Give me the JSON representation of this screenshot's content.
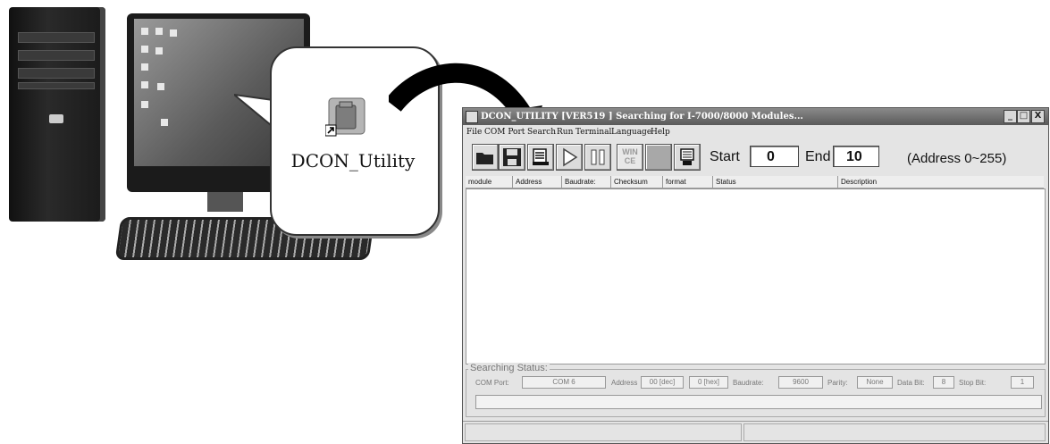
{
  "desktop_icon": {
    "label": "DCON_Utility"
  },
  "window": {
    "title": "DCON_UTILITY [VER519 ] Searching for I-7000/8000 Modules...",
    "controls": {
      "minimize": "_",
      "maximize": "□",
      "close": "X"
    }
  },
  "menu": [
    "File",
    "COM Port",
    "Search",
    "Run",
    "Terminal",
    "Language",
    "Help"
  ],
  "toolbar": {
    "buttons": [
      "open-folder-icon",
      "save-disk-icon",
      "search-modules-icon",
      "run-icon",
      "pause-icon",
      "wince-icon",
      "blank-icon",
      "terminal-icon"
    ],
    "wince_label_line1": "WIN",
    "wince_label_line2": "CE",
    "start_label": "Start",
    "start_value": "0",
    "end_label": "End",
    "end_value": "10",
    "address_hint": "(Address 0~255)"
  },
  "grid": {
    "columns": [
      "module",
      "Address",
      "Baudrate:",
      "Checksum",
      "format",
      "Status",
      "Description"
    ],
    "rows": []
  },
  "search_status": {
    "title": "Searching Status:",
    "com_port_label": "COM Port:",
    "com_port_value": "COM 6",
    "address_label": "Address",
    "address_dec": "00 [dec]",
    "address_hex": "0 [hex]",
    "baudrate_label": "Baudrate:",
    "baudrate_value": "9600",
    "parity_label": "Parity:",
    "parity_value": "None",
    "databit_label": "Data Bit:",
    "databit_value": "8",
    "stopbit_label": "Stop Bit:",
    "stopbit_value": "1"
  },
  "status_bar": {
    "pane1": "",
    "pane2": ""
  }
}
